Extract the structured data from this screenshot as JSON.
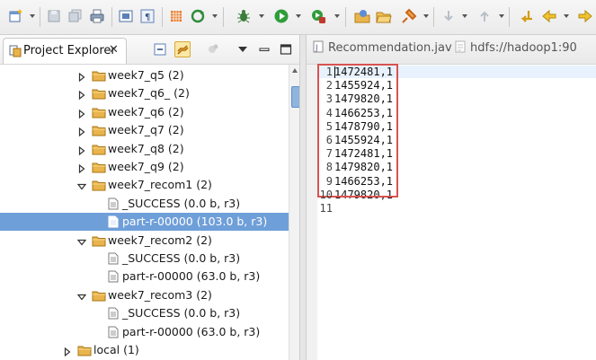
{
  "explorer": {
    "tab_label": "Project Explorer",
    "close_glyph": "✕",
    "tree": [
      {
        "label": "week7_q5 (2)",
        "kind": "folder",
        "expanded": false,
        "depth": 1
      },
      {
        "label": "week7_q6_ (2)",
        "kind": "folder",
        "expanded": false,
        "depth": 1
      },
      {
        "label": "week7_q6 (2)",
        "kind": "folder",
        "expanded": false,
        "depth": 1
      },
      {
        "label": "week7_q7 (2)",
        "kind": "folder",
        "expanded": false,
        "depth": 1
      },
      {
        "label": "week7_q8 (2)",
        "kind": "folder",
        "expanded": false,
        "depth": 1
      },
      {
        "label": "week7_q9 (2)",
        "kind": "folder",
        "expanded": false,
        "depth": 1
      },
      {
        "label": "week7_recom1 (2)",
        "kind": "folder",
        "expanded": true,
        "depth": 1
      },
      {
        "label": "_SUCCESS (0.0 b, r3)",
        "kind": "file",
        "depth": 2
      },
      {
        "label": "part-r-00000 (103.0 b, r3)",
        "kind": "file",
        "depth": 2,
        "selected": true
      },
      {
        "label": "week7_recom2 (2)",
        "kind": "folder",
        "expanded": true,
        "depth": 1
      },
      {
        "label": "_SUCCESS (0.0 b, r3)",
        "kind": "file",
        "depth": 2
      },
      {
        "label": "part-r-00000 (63.0 b, r3)",
        "kind": "file",
        "depth": 2
      },
      {
        "label": "week7_recom3 (2)",
        "kind": "folder",
        "expanded": true,
        "depth": 1
      },
      {
        "label": "_SUCCESS (0.0 b, r3)",
        "kind": "file",
        "depth": 2
      },
      {
        "label": "part-r-00000 (63.0 b, r3)",
        "kind": "file",
        "depth": 2
      },
      {
        "label": "local (1)",
        "kind": "folder",
        "expanded": false,
        "depth": 0
      }
    ]
  },
  "editor": {
    "tabs": [
      {
        "label": "Recommendation.jav",
        "icon": "java-file-icon"
      },
      {
        "label": "hdfs://hadoop1:90",
        "icon": "hdfs-file-icon"
      }
    ],
    "lines": [
      {
        "n": "1",
        "text": "1472481,1"
      },
      {
        "n": "2",
        "text": "1455924,1"
      },
      {
        "n": "3",
        "text": "1479820,1"
      },
      {
        "n": "4",
        "text": "1466253,1"
      },
      {
        "n": "5",
        "text": "1478790,1"
      },
      {
        "n": "6",
        "text": "1455924,1"
      },
      {
        "n": "7",
        "text": "1472481,1"
      },
      {
        "n": "8",
        "text": "1479820,1"
      },
      {
        "n": "9",
        "text": "1466253,1"
      },
      {
        "n": "10",
        "text": "1479820,1"
      },
      {
        "n": "11",
        "text": ""
      }
    ]
  },
  "colors": {
    "selection": "#6f9fd8",
    "highlight_box": "#d9534f",
    "folder": "#e9b44c"
  }
}
